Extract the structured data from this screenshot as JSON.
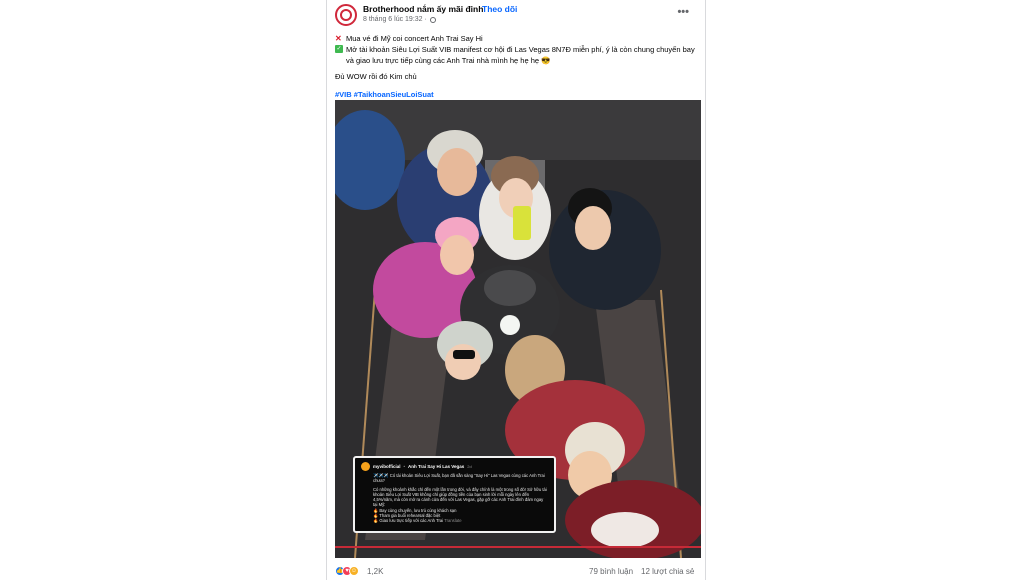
{
  "post": {
    "page_name": "Brotherhood nắm ấy mãi đỉnh",
    "separator": "·",
    "follow_label": "Theo dõi",
    "timestamp": "8 tháng 6 lúc 19:32 ·",
    "more_label": "•••",
    "line1": "Mua vé đi Mỹ coi concert Anh Trai Say Hi",
    "line2": "Mở tài khoản Siêu Lợi Suất VIB manifest cơ hội đi Las Vegas 8N7Đ miễn phí, ý là còn chung chuyến bay và giao lưu trực tiếp cùng các Anh Trai nhà mình hẹ hẹ hẹ 😎",
    "line3": "Đủ WOW rồi đó Kim chủ",
    "hashtag1": "#VIB",
    "hashtag2": "#TaikhoanSieuLoiSuat",
    "icons": {
      "line1": "red-cross-icon",
      "line2": "green-check-icon",
      "more": "more-options-icon",
      "privacy": "globe-icon"
    }
  },
  "ig_card": {
    "username": "myvibofficial",
    "verified": "•",
    "caption_title": "Anh Trai Say Hi Las Vegas",
    "time": "2d",
    "intro": "✈️✈️✈️ Có tài khoản Siêu Lợi Suất, bạn đã sẵn sàng \"Say Hi\" Las Vegas cùng các Anh Trai chưa?",
    "body": "Có những khoảnh khắc chỉ đến một lần trong đời, và đây chính là một trong số đó! Sở hữu tài khoản Siêu Lợi Suất VIB không chỉ giúp đồng tiền của bạn sinh lời mỗi ngày lên đến 4,5%/năm, mà còn mở ra cánh cửa đến với Las Vegas, gặp gỡ các Anh Trai đình đám ngay tại Mỹ:",
    "bullet1": "🔥 Bay cùng chuyến, lưu trú cùng khách sạn",
    "bullet2": "🔥 Tham gia buổi rehearsal đặc biệt",
    "bullet3": "🔥 Giao lưu trực tiếp với các Anh Trai",
    "translate": "Translate"
  },
  "footer": {
    "reaction_count": "1,2K",
    "comments": "79 bình luận",
    "shares": "12 lượt chia sẻ",
    "reactions": [
      "like-icon",
      "love-icon",
      "haha-icon"
    ]
  },
  "colors": {
    "accent": "#0866ff",
    "red": "#c62a37"
  }
}
